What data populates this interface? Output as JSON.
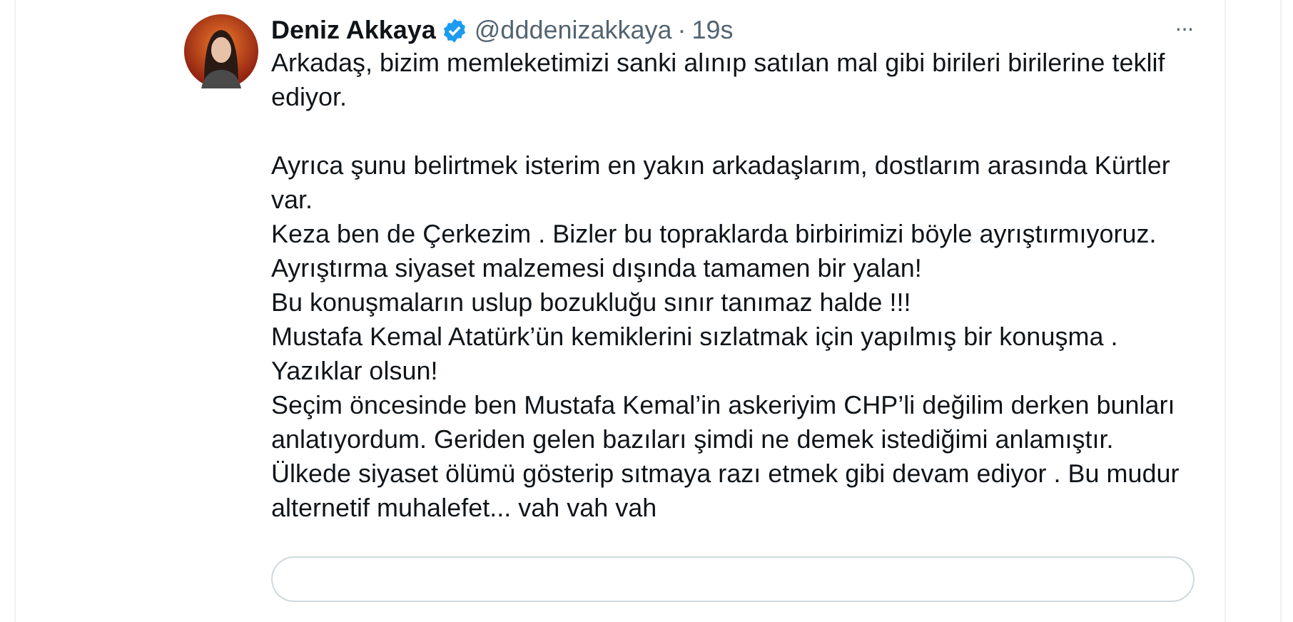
{
  "tweet": {
    "author": {
      "name": "Deniz Akkaya",
      "verified": true,
      "handle": "@dddenizakkaya",
      "separator": "·",
      "time": "19s"
    },
    "more_icon": "···",
    "paragraphs": [
      "Arkadaş, bizim memleketimizi sanki alınıp satılan mal gibi birileri birilerine teklif ediyor.",
      "Ayrıca şunu belirtmek isterim en yakın arkadaşlarım, dostlarım arasında Kürtler var.",
      "Keza ben de Çerkezim . Bizler bu topraklarda birbirimizi böyle ayrıştırmıyoruz. Ayrıştırma siyaset malzemesi dışında tamamen bir yalan!",
      "Bu konuşmaların uslup bozukluğu sınır tanımaz halde !!!",
      "Mustafa Kemal Atatürk’ün kemiklerini sızlatmak için yapılmış bir konuşma . Yazıklar olsun!",
      "Seçim öncesinde  ben Mustafa Kemal’in askeriyim CHP’li değilim derken bunları anlatıyordum. Geriden gelen bazıları şimdi ne demek istediğimi anlamıştır.",
      "Ülkede siyaset ölümü gösterip sıtmaya razı etmek gibi devam ediyor . Bu mudur alternetif muhalefet... vah vah vah"
    ]
  }
}
